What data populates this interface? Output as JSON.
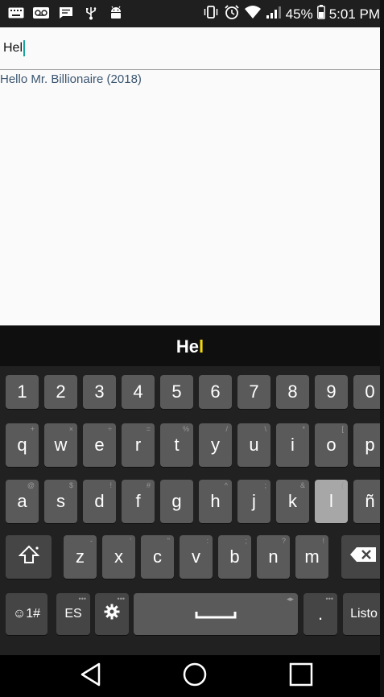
{
  "status_bar": {
    "battery_percent": "45%",
    "time": "5:01 PM",
    "left_icons": [
      "keyboard-icon",
      "voicemail-icon",
      "message-icon",
      "usb-icon",
      "android-icon"
    ],
    "right_icons": [
      "vibrate-icon",
      "alarm-icon",
      "wifi-icon",
      "signal-icon",
      "battery-icon"
    ]
  },
  "search": {
    "value": "Hel"
  },
  "results": [
    {
      "title": "Hello Mr. Billionaire (2018)"
    }
  ],
  "keyboard": {
    "suggestion": {
      "typed": "He",
      "highlight": "l"
    },
    "rows": {
      "numbers": [
        "1",
        "2",
        "3",
        "4",
        "5",
        "6",
        "7",
        "8",
        "9",
        "0"
      ],
      "row1": [
        "q",
        "w",
        "e",
        "r",
        "t",
        "y",
        "u",
        "i",
        "o",
        "p"
      ],
      "row1_hints": [
        "+",
        "×",
        "÷",
        "=",
        "%",
        "/",
        "\\",
        "*",
        "[",
        ""
      ],
      "row2": [
        "a",
        "s",
        "d",
        "f",
        "g",
        "h",
        "j",
        "k",
        "l",
        "ñ"
      ],
      "row2_hints": [
        "@",
        "$",
        "!",
        "#",
        "",
        "^",
        ";",
        "&",
        "(",
        ""
      ],
      "row3": [
        "z",
        "x",
        "c",
        "v",
        "b",
        "n",
        "m"
      ],
      "row3_hints": [
        "-",
        "'",
        "\"",
        ":",
        ";",
        "?",
        "!"
      ]
    },
    "symbols_label": "☺1#",
    "language_label": "ES",
    "more_dots": "•••",
    "period_label": ".",
    "done_label": "Listo",
    "pressed_key": "l"
  },
  "navbar": {
    "icons": [
      "back-icon",
      "home-icon",
      "recents-icon"
    ]
  }
}
